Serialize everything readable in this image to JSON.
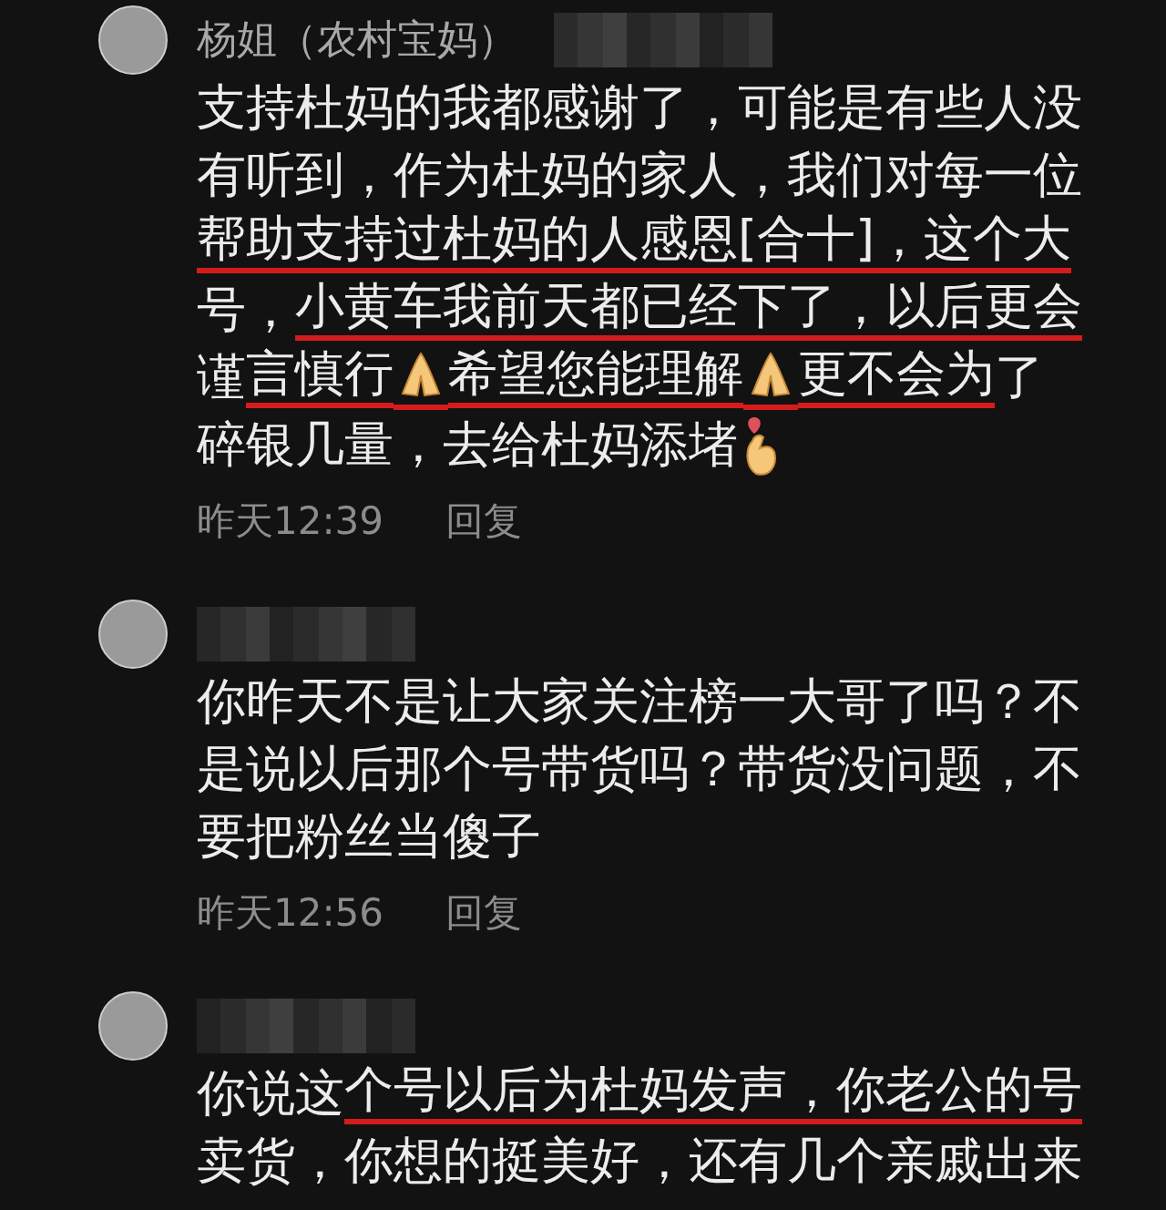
{
  "comments": [
    {
      "name": "杨姐（农村宝妈）",
      "name_blurred": true,
      "lines": [
        [
          {
            "kind": "text",
            "text": "支持杜妈的我都感谢了，可能是有些人没",
            "underlined": false
          }
        ],
        [
          {
            "kind": "text",
            "text": "有听到，作为杜妈的家人，我们对每一位",
            "underlined": false
          }
        ],
        [
          {
            "kind": "text",
            "text": "帮助支持过杜妈的人感恩[合十]，这个大",
            "underlined": true
          }
        ],
        [
          {
            "kind": "text",
            "text": "号，",
            "underlined": false
          },
          {
            "kind": "text",
            "text": "小黄车我前天都已经下了，以后更会",
            "underlined": true
          }
        ],
        [
          {
            "kind": "text",
            "text": "谨",
            "underlined": false
          },
          {
            "kind": "text",
            "text": "言慎行",
            "underlined": true
          },
          {
            "kind": "pray",
            "underlined": true
          },
          {
            "kind": "text",
            "text": "希望您能理解",
            "underlined": true
          },
          {
            "kind": "pray",
            "underlined": true
          },
          {
            "kind": "text",
            "text": "更不会为",
            "underlined": true
          },
          {
            "kind": "text",
            "text": "了",
            "underlined": false
          }
        ],
        [
          {
            "kind": "text",
            "text": "碎银几量，去给杜妈添堵",
            "underlined": false
          },
          {
            "kind": "heart",
            "underlined": false
          }
        ]
      ],
      "time": "昨天12:39",
      "reply": "回复"
    },
    {
      "name_blurred": true,
      "lines": [
        [
          {
            "kind": "text",
            "text": "你昨天不是让大家关注榜一大哥了吗？不",
            "underlined": false
          }
        ],
        [
          {
            "kind": "text",
            "text": "是说以后那个号带货吗？带货没问题，不",
            "underlined": false
          }
        ],
        [
          {
            "kind": "text",
            "text": "要把粉丝当傻子",
            "underlined": false
          }
        ]
      ],
      "time": "昨天12:56",
      "reply": "回复"
    },
    {
      "name_blurred": true,
      "lines": [
        [
          {
            "kind": "text",
            "text": "你说这",
            "underlined": false
          },
          {
            "kind": "text",
            "text": "个号以后为杜妈发声，你老公的号",
            "underlined": true
          }
        ],
        [
          {
            "kind": "text",
            "text": "卖货，你想的挺美好，还有几个亲戚出来",
            "underlined": false
          }
        ]
      ]
    }
  ]
}
